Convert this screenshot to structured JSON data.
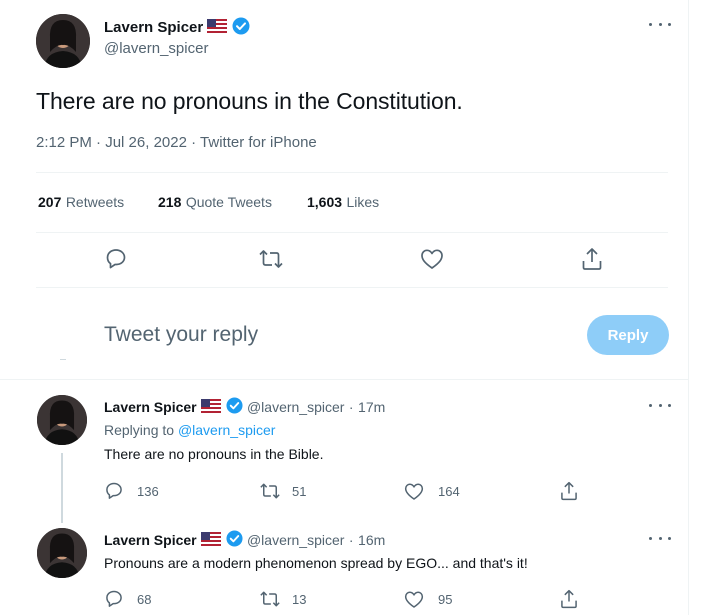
{
  "main_tweet": {
    "author_name": "Lavern Spicer",
    "author_handle": "@lavern_spicer",
    "text": "There are no pronouns in the Constitution.",
    "time": "2:12 PM",
    "date": "Jul 26, 2022",
    "source": "Twitter for iPhone",
    "stats": {
      "retweets_count": "207",
      "retweets_label": "Retweets",
      "quotes_count": "218",
      "quotes_label": "Quote Tweets",
      "likes_count": "1,603",
      "likes_label": "Likes"
    }
  },
  "reply_composer": {
    "placeholder": "Tweet your reply",
    "button_label": "Reply"
  },
  "replies": [
    {
      "author_name": "Lavern Spicer",
      "author_handle": "@lavern_spicer",
      "age": "17m",
      "replying_to_label": "Replying to",
      "replying_to_handle": "@lavern_spicer",
      "text": "There are no pronouns in the Bible.",
      "reply_count": "136",
      "retweet_count": "51",
      "like_count": "164"
    },
    {
      "author_name": "Lavern Spicer",
      "author_handle": "@lavern_spicer",
      "age": "16m",
      "text": "Pronouns are a modern phenomenon spread by EGO... and that's it!",
      "reply_count": "68",
      "retweet_count": "13",
      "like_count": "95"
    }
  ],
  "separator": "·",
  "icons": {
    "verified": "verified-badge-icon",
    "flag": "us-flag-icon",
    "more": "more-options-icon",
    "reply": "reply-icon",
    "retweet": "retweet-icon",
    "like": "like-icon",
    "share": "share-icon"
  },
  "colors": {
    "accent": "#1d9bf0",
    "reply_button_disabled": "#8ecdf8",
    "secondary_text": "#536471",
    "divider": "#eff3f4"
  }
}
